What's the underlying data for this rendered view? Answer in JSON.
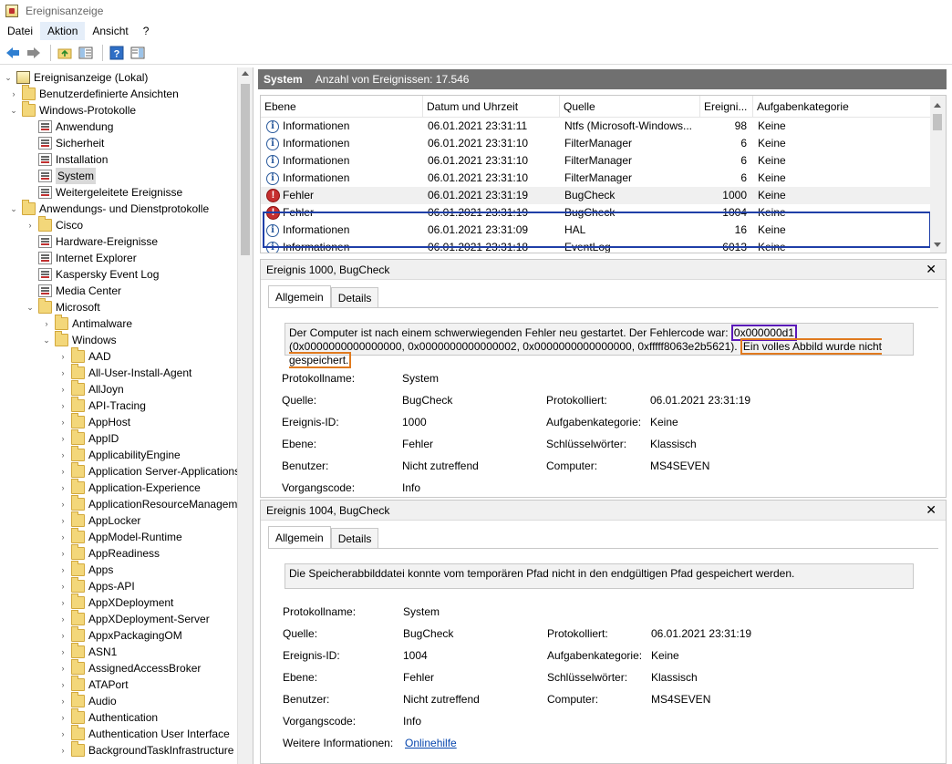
{
  "window": {
    "title": "Ereignisanzeige"
  },
  "menu": [
    "Datei",
    "Aktion",
    "Ansicht",
    "?"
  ],
  "tree": {
    "items": [
      {
        "label": "Ereignisanzeige (Lokal)",
        "icon": "root-icon",
        "exp": "v"
      },
      {
        "label": "Benutzerdefinierte Ansichten",
        "icon": "folder-icon",
        "exp": ">"
      },
      {
        "label": "Windows-Protokolle",
        "icon": "folder-icon",
        "exp": "v"
      },
      {
        "label": "Anwendung",
        "icon": "log-icon",
        "exp": ""
      },
      {
        "label": "Sicherheit",
        "icon": "log-icon",
        "exp": ""
      },
      {
        "label": "Installation",
        "icon": "log-icon",
        "exp": ""
      },
      {
        "label": "System",
        "icon": "log-icon",
        "exp": ""
      },
      {
        "label": "Weitergeleitete Ereignisse",
        "icon": "log-icon",
        "exp": ""
      },
      {
        "label": "Anwendungs- und Dienstprotokolle",
        "icon": "folder-icon",
        "exp": "v"
      },
      {
        "label": "Cisco",
        "icon": "folder-icon",
        "exp": ">"
      },
      {
        "label": "Hardware-Ereignisse",
        "icon": "log-icon",
        "exp": ""
      },
      {
        "label": "Internet Explorer",
        "icon": "log-icon",
        "exp": ""
      },
      {
        "label": "Kaspersky Event Log",
        "icon": "log-icon",
        "exp": ""
      },
      {
        "label": "Media Center",
        "icon": "log-icon",
        "exp": ""
      },
      {
        "label": "Microsoft",
        "icon": "folder-icon",
        "exp": "v"
      },
      {
        "label": "Antimalware",
        "icon": "folder-icon",
        "exp": ">"
      },
      {
        "label": "Windows",
        "icon": "folder-icon",
        "exp": "v"
      },
      {
        "label": "AAD",
        "icon": "folder-icon",
        "exp": ">"
      },
      {
        "label": "All-User-Install-Agent",
        "icon": "folder-icon",
        "exp": ">"
      },
      {
        "label": "AllJoyn",
        "icon": "folder-icon",
        "exp": ">"
      },
      {
        "label": "API-Tracing",
        "icon": "folder-icon",
        "exp": ">"
      },
      {
        "label": "AppHost",
        "icon": "folder-icon",
        "exp": ">"
      },
      {
        "label": "AppID",
        "icon": "folder-icon",
        "exp": ">"
      },
      {
        "label": "ApplicabilityEngine",
        "icon": "folder-icon",
        "exp": ">"
      },
      {
        "label": "Application Server-Applications",
        "icon": "folder-icon",
        "exp": ">"
      },
      {
        "label": "Application-Experience",
        "icon": "folder-icon",
        "exp": ">"
      },
      {
        "label": "ApplicationResourceManagementSystem",
        "icon": "folder-icon",
        "exp": ">"
      },
      {
        "label": "AppLocker",
        "icon": "folder-icon",
        "exp": ">"
      },
      {
        "label": "AppModel-Runtime",
        "icon": "folder-icon",
        "exp": ">"
      },
      {
        "label": "AppReadiness",
        "icon": "folder-icon",
        "exp": ">"
      },
      {
        "label": "Apps",
        "icon": "folder-icon",
        "exp": ">"
      },
      {
        "label": "Apps-API",
        "icon": "folder-icon",
        "exp": ">"
      },
      {
        "label": "AppXDeployment",
        "icon": "folder-icon",
        "exp": ">"
      },
      {
        "label": "AppXDeployment-Server",
        "icon": "folder-icon",
        "exp": ">"
      },
      {
        "label": "AppxPackagingOM",
        "icon": "folder-icon",
        "exp": ">"
      },
      {
        "label": "ASN1",
        "icon": "folder-icon",
        "exp": ">"
      },
      {
        "label": "AssignedAccessBroker",
        "icon": "folder-icon",
        "exp": ">"
      },
      {
        "label": "ATAPort",
        "icon": "folder-icon",
        "exp": ">"
      },
      {
        "label": "Audio",
        "icon": "folder-icon",
        "exp": ">"
      },
      {
        "label": "Authentication",
        "icon": "folder-icon",
        "exp": ">"
      },
      {
        "label": "Authentication User Interface",
        "icon": "folder-icon",
        "exp": ">"
      },
      {
        "label": "BackgroundTaskInfrastructure",
        "icon": "folder-icon",
        "exp": ">"
      }
    ]
  },
  "header": {
    "title": "System",
    "count": "Anzahl von Ereignissen: 17.546"
  },
  "list": {
    "columns": [
      "Ebene",
      "Datum und Uhrzeit",
      "Quelle",
      "Ereigni...",
      "Aufgabenkategorie"
    ],
    "rows": [
      {
        "level": "Informationen",
        "type": "info",
        "date": "06.01.2021 23:31:11",
        "source": "Ntfs (Microsoft-Windows...",
        "id": "98",
        "cat": "Keine"
      },
      {
        "level": "Informationen",
        "type": "info",
        "date": "06.01.2021 23:31:10",
        "source": "FilterManager",
        "id": "6",
        "cat": "Keine"
      },
      {
        "level": "Informationen",
        "type": "info",
        "date": "06.01.2021 23:31:10",
        "source": "FilterManager",
        "id": "6",
        "cat": "Keine"
      },
      {
        "level": "Informationen",
        "type": "info",
        "date": "06.01.2021 23:31:10",
        "source": "FilterManager",
        "id": "6",
        "cat": "Keine"
      },
      {
        "level": "Fehler",
        "type": "error",
        "date": "06.01.2021 23:31:19",
        "source": "BugCheck",
        "id": "1000",
        "cat": "Keine"
      },
      {
        "level": "Fehler",
        "type": "error",
        "date": "06.01.2021 23:31:19",
        "source": "BugCheck",
        "id": "1004",
        "cat": "Keine"
      },
      {
        "level": "Informationen",
        "type": "info",
        "date": "06.01.2021 23:31:09",
        "source": "HAL",
        "id": "16",
        "cat": "Keine"
      },
      {
        "level": "Informationen",
        "type": "info",
        "date": "06.01.2021 23:31:18",
        "source": "EventLog",
        "id": "6013",
        "cat": "Keine"
      }
    ]
  },
  "detail1": {
    "title": "Ereignis 1000, BugCheck",
    "tab_general": "Allgemein",
    "tab_details": "Details",
    "msg_a": "Der Computer ist nach einem schwerwiegenden Fehler neu gestartet. Der Fehlercode war: ",
    "msg_code": "0x000000d1",
    "msg_b": " (0x0000000000000000, 0x0000000000000002, 0x0000000000000000, 0xfffff8063e2b5621). ",
    "msg_c": "Ein volles Abbild wurde nicht gespeichert.",
    "labels": {
      "log": "Protokollname:",
      "source": "Quelle:",
      "id": "Ereignis-ID:",
      "level": "Ebene:",
      "user": "Benutzer:",
      "opcode": "Vorgangscode:",
      "logged": "Protokolliert:",
      "cat": "Aufgabenkategorie:",
      "keywords": "Schlüsselwörter:",
      "computer": "Computer:"
    },
    "values": {
      "log": "System",
      "source": "BugCheck",
      "id": "1000",
      "level": "Fehler",
      "user": "Nicht zutreffend",
      "opcode": "Info",
      "logged": "06.01.2021 23:31:19",
      "cat": "Keine",
      "keywords": "Klassisch",
      "computer": "MS4SEVEN"
    }
  },
  "detail2": {
    "title": "Ereignis 1004, BugCheck",
    "tab_general": "Allgemein",
    "tab_details": "Details",
    "msg": "Die Speicherabbilddatei konnte vom temporären Pfad nicht in den endgültigen Pfad gespeichert werden.",
    "labels": {
      "log": "Protokollname:",
      "source": "Quelle:",
      "id": "Ereignis-ID:",
      "level": "Ebene:",
      "user": "Benutzer:",
      "opcode": "Vorgangscode:",
      "more": "Weitere Informationen:",
      "logged": "Protokolliert:",
      "cat": "Aufgabenkategorie:",
      "keywords": "Schlüsselwörter:",
      "computer": "Computer:"
    },
    "values": {
      "log": "System",
      "source": "BugCheck",
      "id": "1004",
      "level": "Fehler",
      "user": "Nicht zutreffend",
      "opcode": "Info",
      "more": "Onlinehilfe",
      "logged": "06.01.2021 23:31:19",
      "cat": "Keine",
      "keywords": "Klassisch",
      "computer": "MS4SEVEN"
    }
  },
  "colors": {
    "header_bg": "#707070",
    "selection_box": "#1f3fa8",
    "code_mark": "#5a18b8",
    "note_mark": "#e07a1f",
    "error": "#c62f2f",
    "info": "#2a5a9c"
  }
}
